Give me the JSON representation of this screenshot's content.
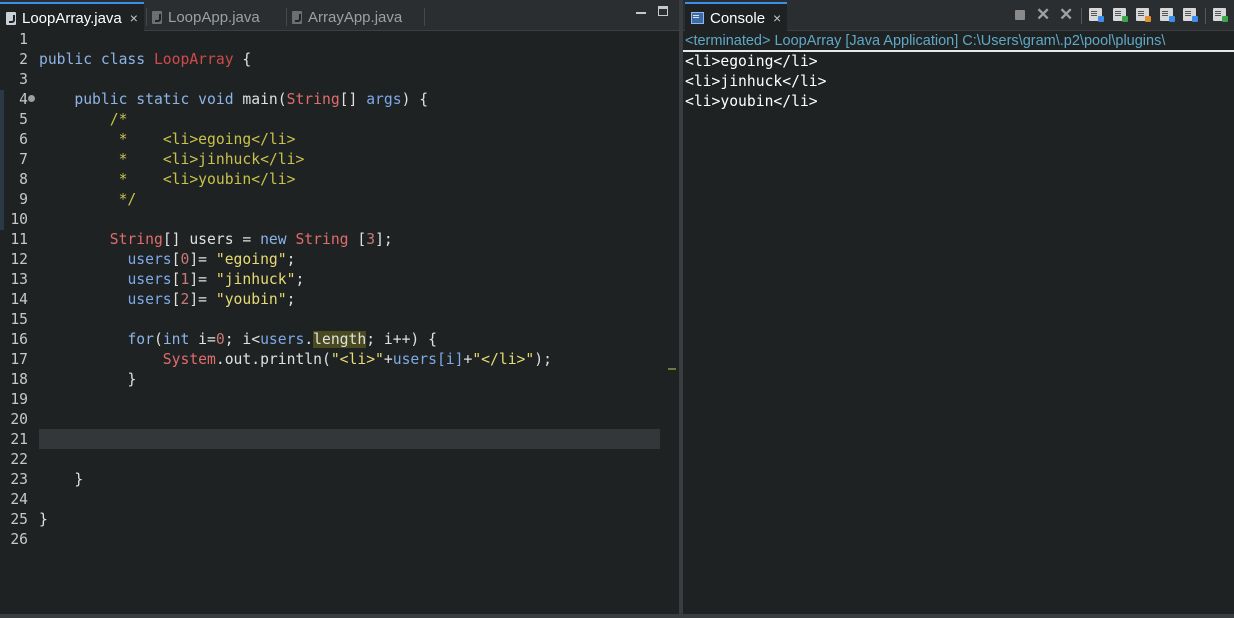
{
  "editor": {
    "tabs": [
      {
        "label": "LoopArray.java",
        "close": "×"
      },
      {
        "label": "LoopApp.java"
      },
      {
        "label": "ArrayApp.java"
      }
    ],
    "line_numbers": [
      "1",
      "2",
      "3",
      "4",
      "5",
      "6",
      "7",
      "8",
      "9",
      "10",
      "11",
      "12",
      "13",
      "14",
      "15",
      "16",
      "17",
      "18",
      "19",
      "20",
      "21",
      "22",
      "23",
      "24",
      "25",
      "26"
    ],
    "code": {
      "l2": {
        "public": "public",
        "class": "class",
        "name": "LoopArray",
        "brace": "{"
      },
      "l4": {
        "mods": "public static void",
        "method": "main(",
        "type": "String",
        "arr": "[]",
        "param": "args",
        "rest": ") {"
      },
      "l5": "/*",
      "l6": {
        "star": " *    ",
        "text": "<li>egoing</li>"
      },
      "l7": {
        "star": " *    ",
        "text": "<li>jinhuck</li>"
      },
      "l8": {
        "star": " *    ",
        "text": "<li>youbin</li>"
      },
      "l9": " */",
      "l11": {
        "type": "String",
        "mid": "[] ",
        "var": "users",
        "eq": " = ",
        "new": "new",
        "type2": "String",
        "sp": " [",
        "num": "3",
        "end": "];"
      },
      "l12": {
        "var": "users",
        "open": "[",
        "idx": "0",
        "close": "]= ",
        "str": "\"egoing\"",
        "end": ";"
      },
      "l13": {
        "var": "users",
        "open": "[",
        "idx": "1",
        "close": "]= ",
        "str": "\"jinhuck\"",
        "end": ";"
      },
      "l14": {
        "var": "users",
        "open": "[",
        "idx": "2",
        "close": "]= ",
        "str": "\"youbin\"",
        "end": ";"
      },
      "l16": {
        "for": "for",
        "p1": "(",
        "int": "int",
        "p2": " i=",
        "zero": "0",
        "p3": "; i<",
        "users": "users",
        "dot": ".",
        "length": "length",
        "p4": "; i++) {"
      },
      "l17": {
        "sys": "System",
        "p1": ".out.println(",
        "s1": "\"<li>\"",
        "plus": "+",
        "users": "users",
        "idx": "[i]",
        "plus2": "+",
        "s2": "\"</li>\"",
        "end": ");"
      },
      "l18": "}",
      "l23": "}",
      "l25": "}"
    }
  },
  "console": {
    "tab_label": "Console",
    "close": "×",
    "status": "<terminated> LoopArray [Java Application] C:\\Users\\gram\\.p2\\pool\\plugins\\",
    "output": [
      "<li>egoing</li>",
      "<li>jinhuck</li>",
      "<li>youbin</li>"
    ]
  }
}
